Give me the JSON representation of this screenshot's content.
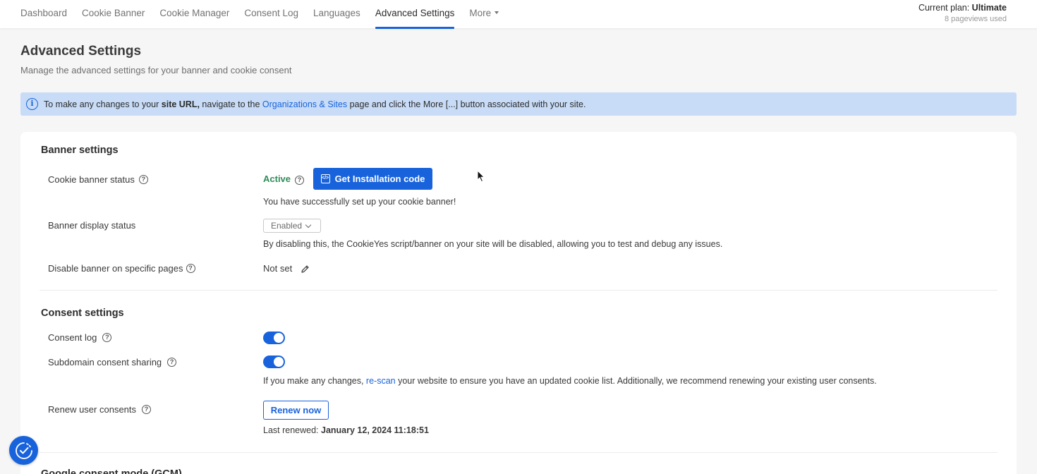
{
  "nav": {
    "tabs": [
      {
        "label": "Dashboard"
      },
      {
        "label": "Cookie Banner"
      },
      {
        "label": "Cookie Manager"
      },
      {
        "label": "Consent Log"
      },
      {
        "label": "Languages"
      },
      {
        "label": "Advanced Settings",
        "active": true
      },
      {
        "label": "More"
      }
    ],
    "plan_prefix": "Current plan: ",
    "plan_name": "Ultimate",
    "pageviews": "8 pageviews used"
  },
  "header": {
    "title": "Advanced Settings",
    "subtitle": "Manage the advanced settings for your banner and cookie consent"
  },
  "info": {
    "text_1": "To make any changes to your ",
    "bold": "site URL,",
    "text_2": " navigate to the ",
    "link": "Organizations & Sites",
    "text_3": " page and click the More [...] button associated with your site."
  },
  "banner_settings": {
    "title": "Banner settings",
    "status_label": "Cookie banner status",
    "status_value": "Active",
    "install_button": "Get Installation code",
    "status_message": "You have successfully set up your cookie banner!",
    "display_label": "Banner display status",
    "display_value": "Enabled",
    "display_note": "By disabling this, the CookieYes script/banner on your site will be disabled, allowing you to test and debug any issues.",
    "disable_label": "Disable banner on specific pages",
    "disable_value": "Not set"
  },
  "consent_settings": {
    "title": "Consent settings",
    "log_label": "Consent log",
    "log_enabled": true,
    "subdomain_label": "Subdomain consent sharing",
    "subdomain_enabled": true,
    "note_1": "If you make any changes, ",
    "note_link": "re-scan",
    "note_2": " your website to ensure you have an updated cookie list. Additionally, we recommend renewing your existing user consents.",
    "renew_label": "Renew user consents",
    "renew_button": "Renew now",
    "last_renewed_label": "Last renewed: ",
    "last_renewed_value": "January 12, 2024 11:18:51"
  },
  "gcm": {
    "title": "Google consent mode (GCM)"
  },
  "colors": {
    "accent": "#1863dc",
    "active_green": "#2e8b57",
    "info_bg": "#c8dcf7"
  }
}
